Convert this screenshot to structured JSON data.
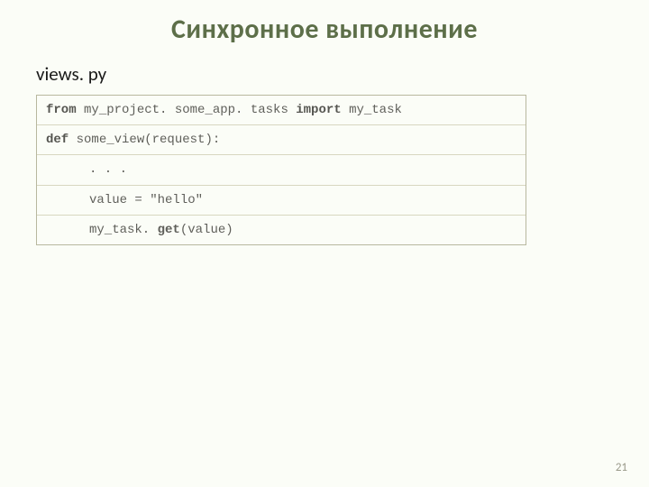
{
  "slide": {
    "title": "Синхронное выполнение",
    "filename": "views. py",
    "code": {
      "kw_from": "from",
      "module": " my_project. some_app. tasks ",
      "kw_import": "import",
      "import_target": " my_task",
      "kw_def": "def",
      "func_sig": " some_view(request):",
      "dots": ". . .",
      "line_value": "value = \"hello\"",
      "call_pre": "my_task. ",
      "call_method": "get",
      "call_post": "(value)"
    },
    "page_number": "21"
  }
}
